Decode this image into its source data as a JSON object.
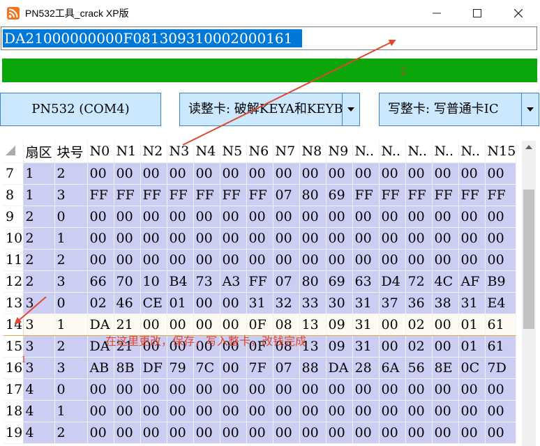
{
  "window": {
    "title": "PN532工具_crack XP版",
    "minimize_label": "—",
    "maximize_label": "☐",
    "close_label": "✕"
  },
  "uid_field": {
    "value": "DA21000000000F081309310002000161"
  },
  "status": {
    "annotation": "2"
  },
  "controls": {
    "port_button": "PN532 (COM4)",
    "read_select": "读整卡: 破解KEYA和KEYB",
    "write_select": "写整卡: 写普通卡IC"
  },
  "grid": {
    "columns": [
      "扇区",
      "块号",
      "N0",
      "N1",
      "N2",
      "N3",
      "N4",
      "N5",
      "N6",
      "N7",
      "N8",
      "N9",
      "N..",
      "N..",
      "N..",
      "N..",
      "N..",
      "N15"
    ],
    "rows": [
      {
        "num": "7",
        "cells": [
          "1",
          "2",
          "00",
          "00",
          "00",
          "00",
          "00",
          "00",
          "00",
          "00",
          "00",
          "00",
          "00",
          "00",
          "00",
          "00",
          "00",
          "00"
        ]
      },
      {
        "num": "8",
        "cells": [
          "1",
          "3",
          "FF",
          "FF",
          "FF",
          "FF",
          "FF",
          "FF",
          "FF",
          "07",
          "80",
          "69",
          "FF",
          "FF",
          "FF",
          "FF",
          "FF",
          "FF"
        ]
      },
      {
        "num": "9",
        "cells": [
          "2",
          "0",
          "00",
          "00",
          "00",
          "00",
          "00",
          "00",
          "00",
          "00",
          "00",
          "00",
          "00",
          "00",
          "00",
          "00",
          "00",
          "00"
        ]
      },
      {
        "num": "10",
        "cells": [
          "2",
          "1",
          "00",
          "00",
          "00",
          "00",
          "00",
          "00",
          "00",
          "00",
          "00",
          "00",
          "00",
          "00",
          "00",
          "00",
          "00",
          "00"
        ]
      },
      {
        "num": "11",
        "cells": [
          "2",
          "2",
          "00",
          "00",
          "00",
          "00",
          "00",
          "00",
          "00",
          "00",
          "00",
          "00",
          "00",
          "00",
          "00",
          "00",
          "00",
          "00"
        ]
      },
      {
        "num": "12",
        "cells": [
          "2",
          "3",
          "66",
          "70",
          "10",
          "B4",
          "73",
          "A3",
          "FF",
          "07",
          "80",
          "69",
          "63",
          "D4",
          "72",
          "4C",
          "AF",
          "B9"
        ]
      },
      {
        "num": "13",
        "cells": [
          "3",
          "0",
          "02",
          "46",
          "CE",
          "01",
          "00",
          "00",
          "31",
          "32",
          "33",
          "30",
          "31",
          "37",
          "36",
          "38",
          "31",
          "E4"
        ]
      },
      {
        "num": "14",
        "cells": [
          "3",
          "1",
          "DA",
          "21",
          "00",
          "00",
          "00",
          "00",
          "0F",
          "08",
          "13",
          "09",
          "31",
          "00",
          "02",
          "00",
          "01",
          "61"
        ]
      },
      {
        "num": "15",
        "cells": [
          "3",
          "2",
          "DA",
          "21",
          "00",
          "00",
          "00",
          "00",
          "0F",
          "08",
          "13",
          "09",
          "31",
          "00",
          "02",
          "00",
          "01",
          "61"
        ]
      },
      {
        "num": "16",
        "cells": [
          "3",
          "3",
          "AB",
          "8B",
          "DF",
          "79",
          "7C",
          "00",
          "7F",
          "07",
          "88",
          "DA",
          "28",
          "6A",
          "56",
          "8E",
          "0C",
          "7D"
        ]
      },
      {
        "num": "17",
        "cells": [
          "4",
          "0",
          "00",
          "00",
          "00",
          "00",
          "00",
          "00",
          "00",
          "00",
          "00",
          "00",
          "00",
          "00",
          "00",
          "00",
          "00",
          "00"
        ]
      },
      {
        "num": "18",
        "cells": [
          "4",
          "1",
          "00",
          "00",
          "00",
          "00",
          "00",
          "00",
          "00",
          "00",
          "00",
          "00",
          "00",
          "00",
          "00",
          "00",
          "00",
          "00"
        ]
      },
      {
        "num": "19",
        "cells": [
          "4",
          "2",
          "00",
          "00",
          "00",
          "00",
          "00",
          "00",
          "00",
          "00",
          "00",
          "00",
          "00",
          "00",
          "00",
          "00",
          "00",
          "00"
        ]
      }
    ],
    "selected_row": "14"
  },
  "annotations": {
    "note": "在这里更改，保存，写入整卡，改钱完成",
    "label_1": "1",
    "color": "#e2462e"
  },
  "colors": {
    "status_green": "#0aa60a",
    "cell_bg": "#cccdf3",
    "control_bg": "#cce8ff",
    "selection_blue": "#0078d7"
  }
}
